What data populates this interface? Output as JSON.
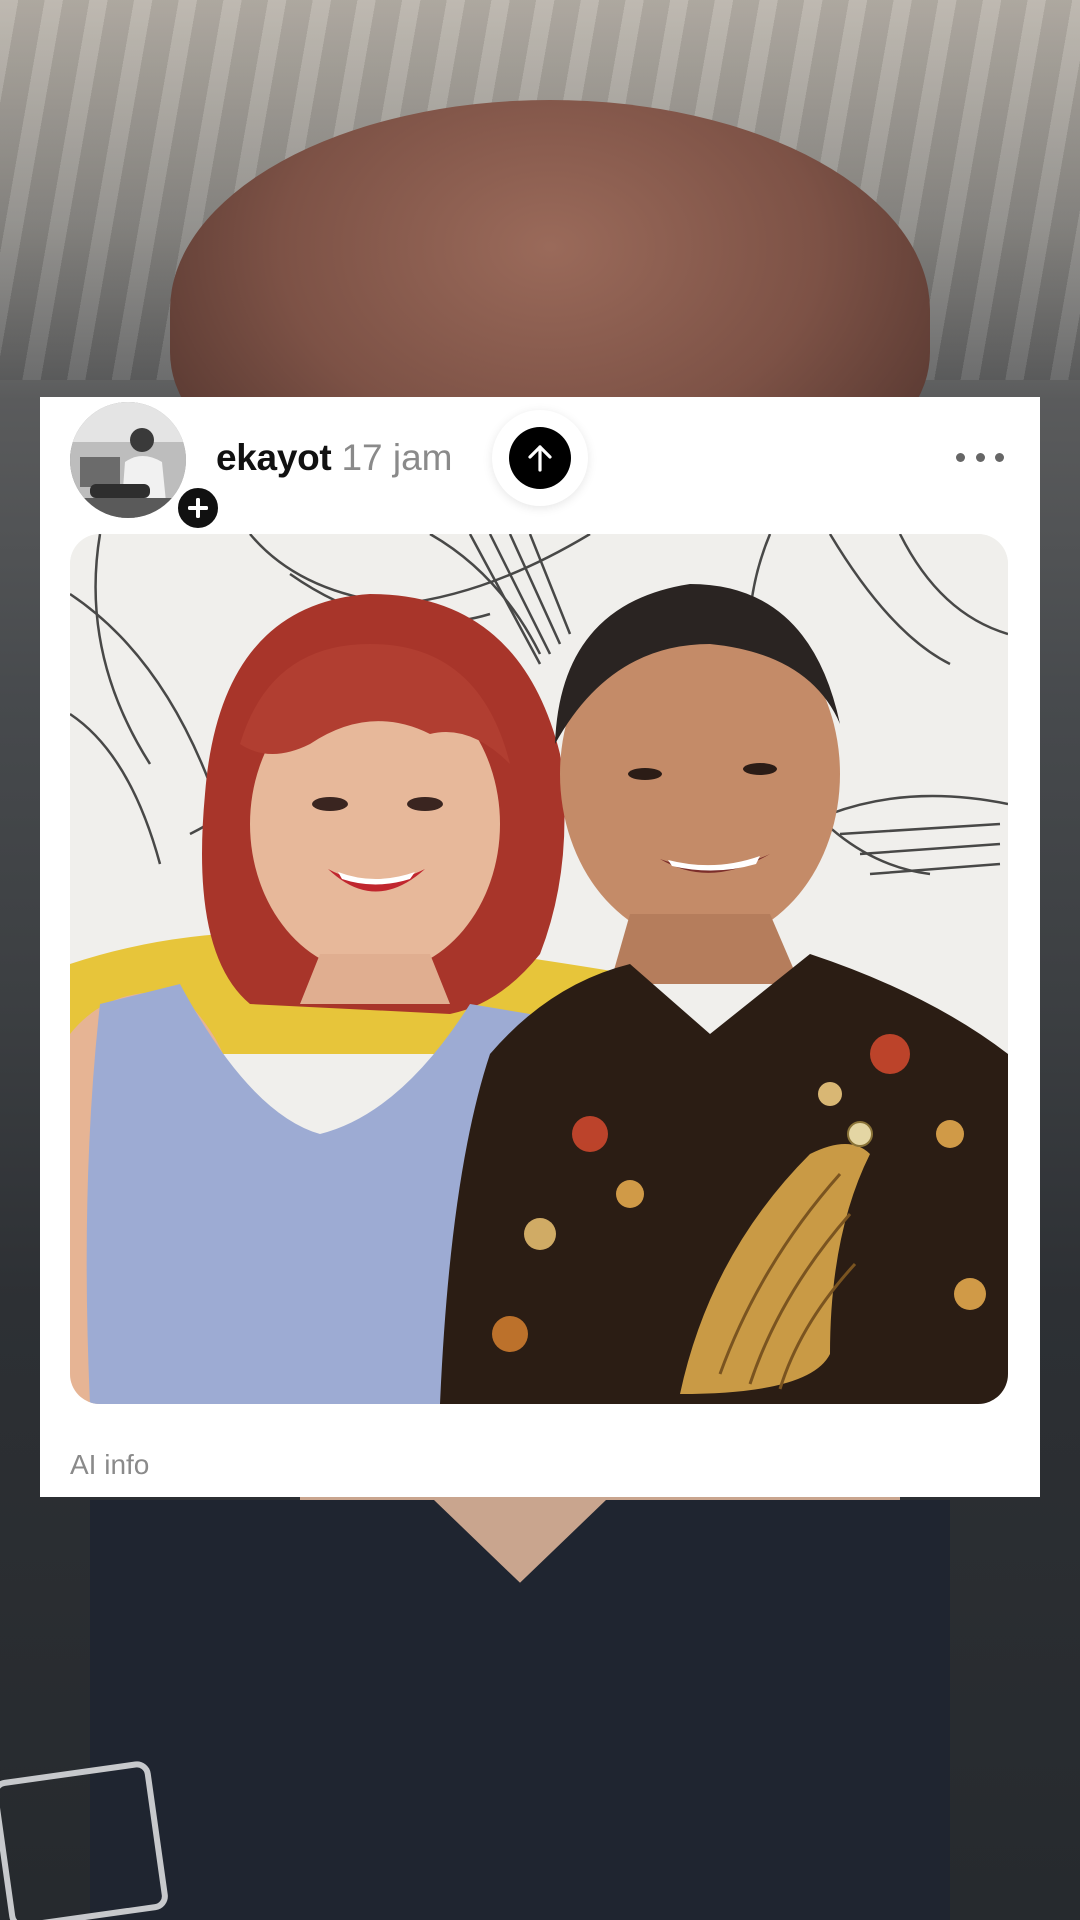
{
  "post": {
    "username": "ekayot",
    "time_ago": "17 jam",
    "ai_info_label": "AI info"
  },
  "icons": {
    "follow": "plus-icon",
    "upload": "arrow-up-icon",
    "more": "ellipsis-icon"
  },
  "colors": {
    "card_background": "#ffffff",
    "username_text": "#111111",
    "secondary_text": "#8a8a8a",
    "button_black": "#000000"
  }
}
